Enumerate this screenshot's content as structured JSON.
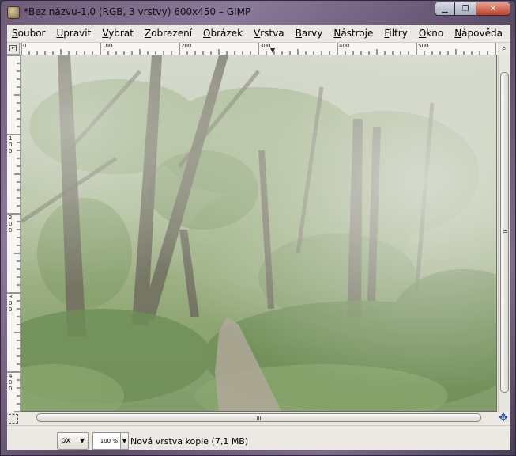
{
  "window": {
    "title": "*Bez názvu-1.0 (RGB, 3 vrstvy) 600x450 – GIMP",
    "minimize_glyph": "▁",
    "maximize_glyph": "❐",
    "close_glyph": "✕"
  },
  "menubar": {
    "items": [
      {
        "first": "S",
        "rest": "oubor"
      },
      {
        "first": "U",
        "rest": "pravit"
      },
      {
        "first": "V",
        "rest": "ybrat"
      },
      {
        "first": "Z",
        "rest": "obrazení"
      },
      {
        "first": "O",
        "rest": "brázek"
      },
      {
        "first": "V",
        "rest": "rstva"
      },
      {
        "first": "B",
        "rest": "arvy"
      },
      {
        "first": "N",
        "rest": "ástroje"
      },
      {
        "first": "F",
        "rest": "iltry"
      },
      {
        "first": "O",
        "rest": "kno"
      },
      {
        "first": "N",
        "rest": "ápověda"
      }
    ]
  },
  "rulers": {
    "top_labels": [
      "0",
      "100",
      "200",
      "300",
      "400",
      "500"
    ],
    "left_labels": [
      "1\n0\n0",
      "2\n0\n0",
      "3\n0\n0",
      "4\n0\n0"
    ]
  },
  "statusbar": {
    "unit": "px",
    "zoom": "100 %",
    "message": "Nová vrstva kopie (7,1 MB)"
  },
  "colors": {
    "canvas_fog": "#c9cdc2",
    "foliage_dark": "#4c6b36",
    "foliage_light": "#9bb479",
    "path": "#a69b8c"
  }
}
